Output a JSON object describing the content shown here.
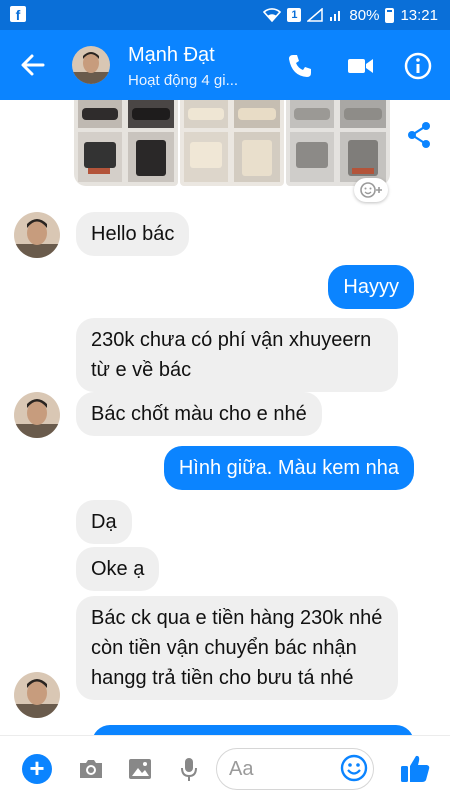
{
  "status_bar": {
    "app_icon": "f",
    "notif_count": "1",
    "battery": "80%",
    "time": "13:21"
  },
  "header": {
    "name": "Mạnh Đạt",
    "status": "Hoạt động 4 gi..."
  },
  "messages": [
    {
      "side": "in",
      "text": "Hello bác"
    },
    {
      "side": "out",
      "text": "Hayyy"
    },
    {
      "side": "in",
      "text": "230k chưa có phí vận xhuyeern từ e về bác"
    },
    {
      "side": "in",
      "text": "Bác chốt màu cho e nhé"
    },
    {
      "side": "out",
      "text": "Hình giữa. Màu kem nha"
    },
    {
      "side": "in",
      "text": "Dạ"
    },
    {
      "side": "in",
      "text": "Oke ạ"
    },
    {
      "side": "in",
      "text": "Bác ck qua e tiền hàng 230k nhé còn tiền vận chuyển bác nhận hangg trả tiền cho bưu tá nhé"
    }
  ],
  "composer": {
    "placeholder": "Aa"
  },
  "colors": {
    "header": "#0b84ff",
    "status_bar": "#0a6fd8",
    "incoming_bubble": "#efefef",
    "outgoing_bubble": "#0b84ff"
  },
  "icons": [
    "back-arrow-icon",
    "phone-icon",
    "video-camera-icon",
    "info-icon",
    "share-icon",
    "add-reaction-icon",
    "plus-icon",
    "camera-icon",
    "gallery-icon",
    "microphone-icon",
    "emoji-icon",
    "thumbs-up-icon"
  ]
}
